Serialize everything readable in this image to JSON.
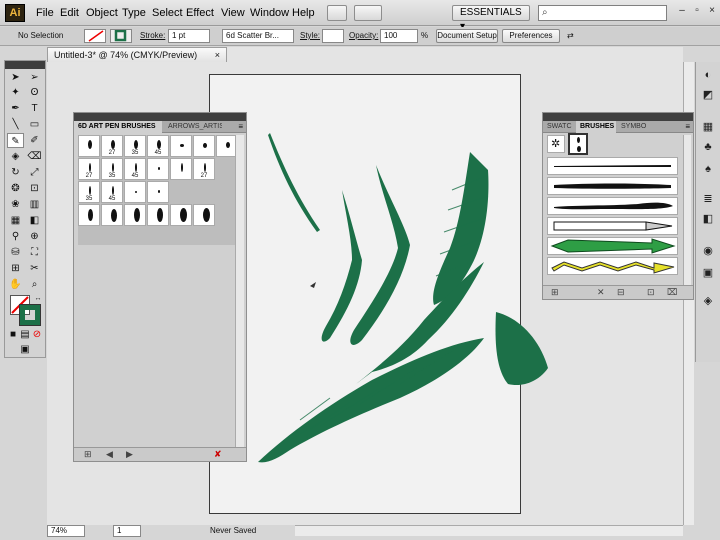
{
  "menubar": {
    "logo": "Ai",
    "items": [
      "File",
      "Edit",
      "Object",
      "Type",
      "Select",
      "Effect",
      "View",
      "Window",
      "Help"
    ],
    "workspace": "ESSENTIALS",
    "search_placeholder": ""
  },
  "control": {
    "selection": "No Selection",
    "stroke_label": "Stroke:",
    "stroke_value": "1 pt",
    "brush_value": "6d Scatter Br...",
    "style_label": "Style:",
    "opacity_label": "Opacity:",
    "opacity_value": "100",
    "opacity_unit": "%",
    "doc_setup": "Document Setup",
    "preferences": "Preferences"
  },
  "document": {
    "tab_title": "Untitled-3* @ 74% (CMYK/Preview)",
    "close": "×"
  },
  "brush_panel_left": {
    "tabs": [
      "6D ART PEN BRUSHES",
      "ARROWS_ARTIS"
    ],
    "rows": [
      [
        "",
        "27",
        "35",
        "45",
        "",
        "",
        ""
      ],
      [
        "27",
        "35",
        "45",
        "",
        "",
        "27"
      ],
      [
        "35",
        "45",
        "",
        ""
      ],
      [
        "",
        "",
        "",
        "",
        "",
        ""
      ]
    ]
  },
  "brush_panel_right": {
    "tabs": [
      "SWATC",
      "BRUSHES",
      "SYMBO"
    ]
  },
  "status": {
    "zoom": "74%",
    "page": "1",
    "state": "Never Saved"
  },
  "colors": {
    "ink": "#1c7048",
    "chrome": "#d3d3d3",
    "panel_head": "#3f3f3f"
  }
}
